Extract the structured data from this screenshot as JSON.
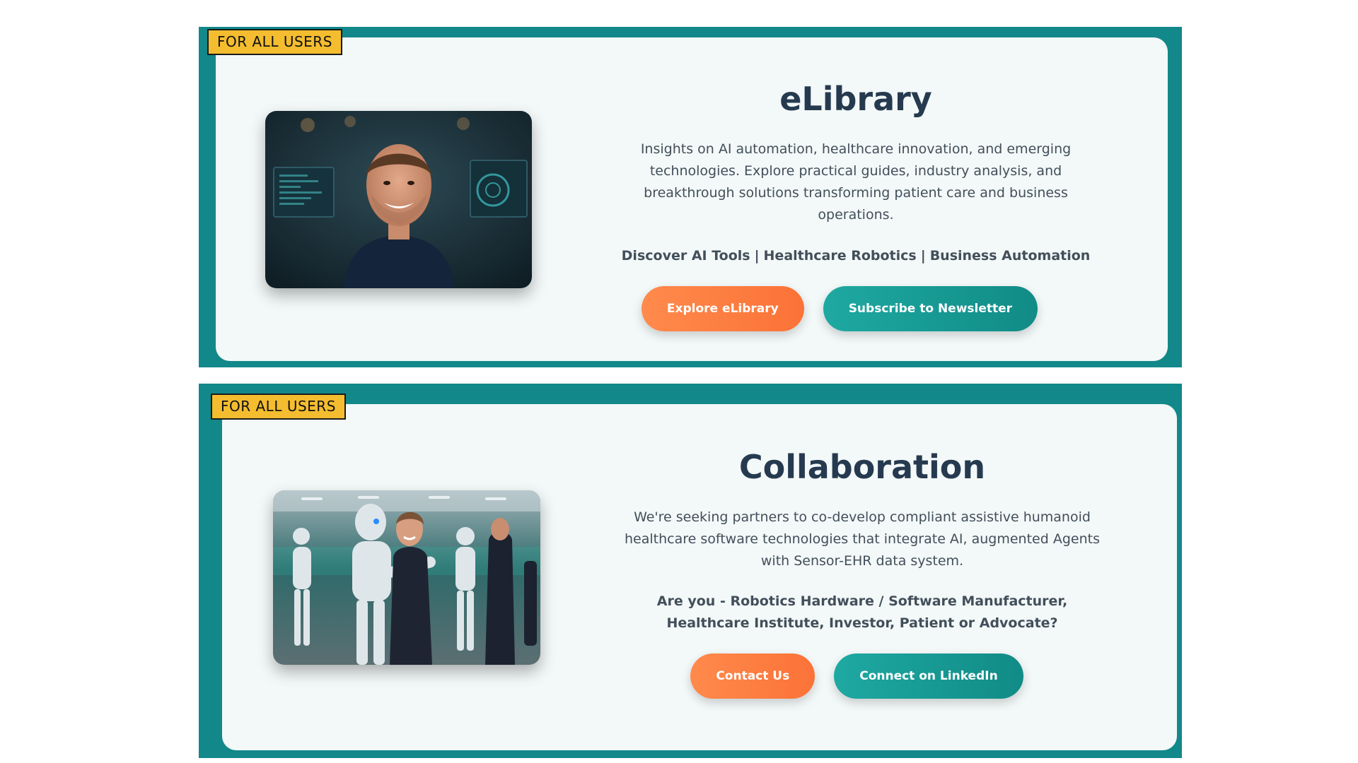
{
  "colors": {
    "section_bg": "#12888a",
    "card_bg": "#f3f8f8",
    "badge_bg": "#f4bd2f",
    "title": "#263a4f",
    "button_orange": "#fb7a3e",
    "button_teal": "#189d98"
  },
  "sections": [
    {
      "badge": "FOR ALL USERS",
      "image_icon": "portrait-photo-icon",
      "title": "eLibrary",
      "description": "Insights on AI automation, healthcare innovation, and emerging technologies. Explore practical guides, industry analysis, and breakthrough solutions transforming patient care and business operations.",
      "links": [
        "Discover AI Tools",
        "Healthcare Robotics",
        "Business Automation"
      ],
      "separator": "|",
      "buttons": [
        "Explore eLibrary",
        "Subscribe to Newsletter"
      ]
    },
    {
      "badge": "FOR ALL USERS",
      "image_icon": "robots-collaboration-photo-icon",
      "title": "Collaboration",
      "description": "We're seeking partners to co-develop compliant assistive humanoid healthcare software technologies that integrate AI, augmented Agents with Sensor-EHR data system.",
      "question": "Are you - Robotics Hardware / Software Manufacturer, Healthcare Institute, Investor, Patient or Advocate?",
      "buttons": [
        "Contact Us",
        "Connect on LinkedIn"
      ]
    }
  ]
}
